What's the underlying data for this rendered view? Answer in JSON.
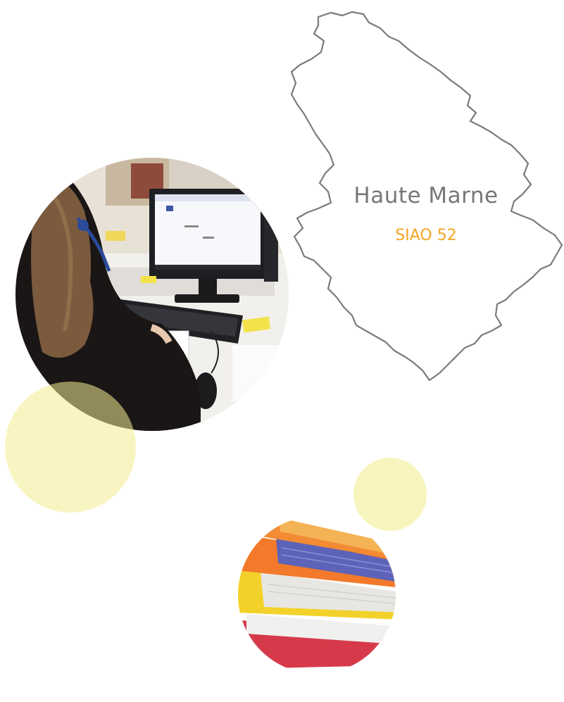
{
  "map": {
    "title": "Haute Marne",
    "subtitle": "SIAO 52",
    "outline_color": "#7a7a7a",
    "title_color": "#777777",
    "subtitle_color": "#f5a623"
  },
  "photos": {
    "office": {
      "subject": "person at a desk using a computer with a headset"
    },
    "folders": {
      "subject": "stack of colored paper folders"
    }
  },
  "decorations": {
    "circle_color": "#f4f0a0"
  }
}
